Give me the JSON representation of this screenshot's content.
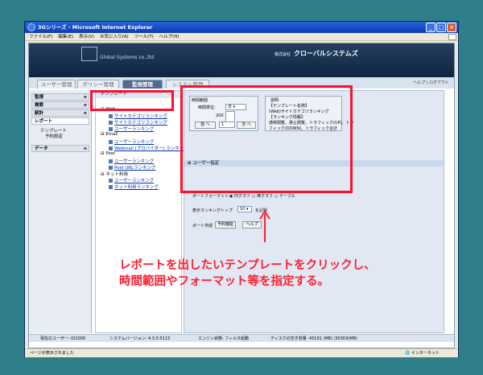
{
  "window": {
    "title": "3Gシリーズ - Microsoft Internet Explorer",
    "menu": [
      "ファイル(F)",
      "編集(E)",
      "表示(V)",
      "お気に入り(A)",
      "ツール(T)",
      "ヘルプ(H)"
    ],
    "controls": {
      "minimize": "_",
      "maximize": "□",
      "close": "×"
    }
  },
  "header": {
    "logo_text": "Global Systems co.,ltd",
    "company_prefix": "株式会社",
    "company_name": "クローバルシステムズ"
  },
  "tabs": [
    {
      "label": "ユーザー管理",
      "active": false
    },
    {
      "label": "ポリシー管理",
      "active": false
    },
    {
      "label": "監視管理",
      "active": true
    },
    {
      "label": "システム管理",
      "active": false
    }
  ],
  "help_link": "ヘルプ | ログアウト",
  "sidebar": {
    "sections": [
      {
        "label": "監視"
      },
      {
        "label": "検索"
      },
      {
        "label": "統計"
      },
      {
        "label": "レポート"
      },
      {
        "label": "データ"
      }
    ],
    "report_children": [
      "テンプレート",
      "予約設定"
    ]
  },
  "template_panel": {
    "header": "テンプレート",
    "nodes": {
      "web": "Web",
      "web_items": [
        "サイトカテゴリランキング",
        "サイトカテゴリランキング",
        "ユーザーランキング"
      ],
      "email": "Email",
      "email_items": [
        "ユーザーランキング",
        "Webmail (プロバイダー) ランキング"
      ],
      "post": "Post",
      "post_items": [
        "ユーザーランキング",
        "Post URLランキング"
      ],
      "net": "ネット利用",
      "net_items": [
        "ユーザーランキング",
        "ネット利用ランキング"
      ]
    }
  },
  "form": {
    "range_title": "時間範囲",
    "unit_label": "時間単位:",
    "unit_value": "日",
    "year_label": "200",
    "prev_btn": "前 へ",
    "next_btn": "次 へ",
    "day_value": "1",
    "info_title": "説明",
    "info_lines": [
      "【テンプレート名称】",
      "(Web)サイトカテゴリランキング",
      "【ランキング情報】",
      "通常閲覧、禁止閲覧、トラフィック(UP)、トラ",
      "フィック(DOWN)、トラフィック合計"
    ],
    "user_section": "ユーザー指定",
    "format_label": "ポートフォーマット:",
    "format_options": [
      "円グラフ",
      "棒グラフ",
      "テーブル"
    ],
    "ranking_label": "表示ランキングトップ",
    "ranking_value": "10",
    "ranking_suffix": "を記録",
    "report_label": "ポート作成",
    "buttons": [
      "予約機能",
      "ヘルプ"
    ]
  },
  "status_footer": {
    "user_label": "現在のユーザー: IO1000",
    "version_label": "システムバージョン: 4.3.0.5113",
    "engine_label": "エンジン状態: フィルタ起動",
    "disk_label": "ディスクの空き容量: 45191 (MB) /30303(MB)"
  },
  "ie_status": {
    "text": "ページが表示されました",
    "zone": "インターネット"
  },
  "annotation": {
    "caption_line1": "レポートを出したいテンプレートをクリックし、",
    "caption_line2": "時間範囲やフォーマット等を指定する。",
    "highlight_color": "#ff0f2f"
  }
}
